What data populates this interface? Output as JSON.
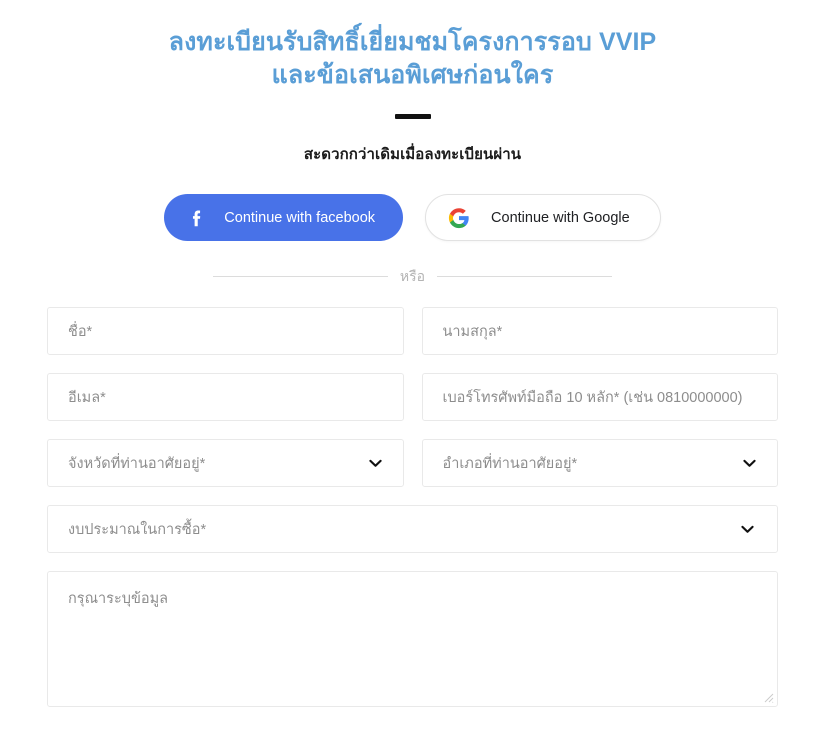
{
  "heading": {
    "line1": "ลงทะเบียนรับสิทธิ์เยี่ยมชมโครงการรอบ VVIP",
    "line2": "และข้อเสนอพิเศษก่อนใคร",
    "color": "#5a9ed6"
  },
  "subtitle": "สะดวกกว่าเดิมเมื่อลงทะเบียนผ่าน",
  "social": {
    "facebook": {
      "label": "Continue with facebook",
      "icon": "facebook-icon",
      "bg_color": "#4872e8",
      "text_color": "#ffffff"
    },
    "google": {
      "label": "Continue with Google",
      "icon": "google-icon",
      "bg_color": "#ffffff",
      "text_color": "#202124",
      "border_color": "#e2e2e2"
    }
  },
  "divider": {
    "text": "หรือ",
    "line_color": "#dcdcdc",
    "text_color": "#b4b4b4"
  },
  "form": {
    "first_name": {
      "placeholder": "ชื่อ*"
    },
    "last_name": {
      "placeholder": "นามสกุล*"
    },
    "email": {
      "placeholder": "อีเมล*"
    },
    "phone": {
      "placeholder": "เบอร์โทรศัพท์มือถือ 10 หลัก* (เช่น 0810000000)"
    },
    "province": {
      "placeholder": "จังหวัดที่ท่านอาศัยอยู่*"
    },
    "district": {
      "placeholder": "อำเภอที่ท่านอาศัยอยู่*"
    },
    "budget": {
      "placeholder": "งบประมาณในการซื้อ*"
    },
    "message": {
      "placeholder": "กรุณาระบุข้อมูล"
    },
    "border_color": "#e9e9e9",
    "placeholder_color": "#8d8d8d"
  }
}
